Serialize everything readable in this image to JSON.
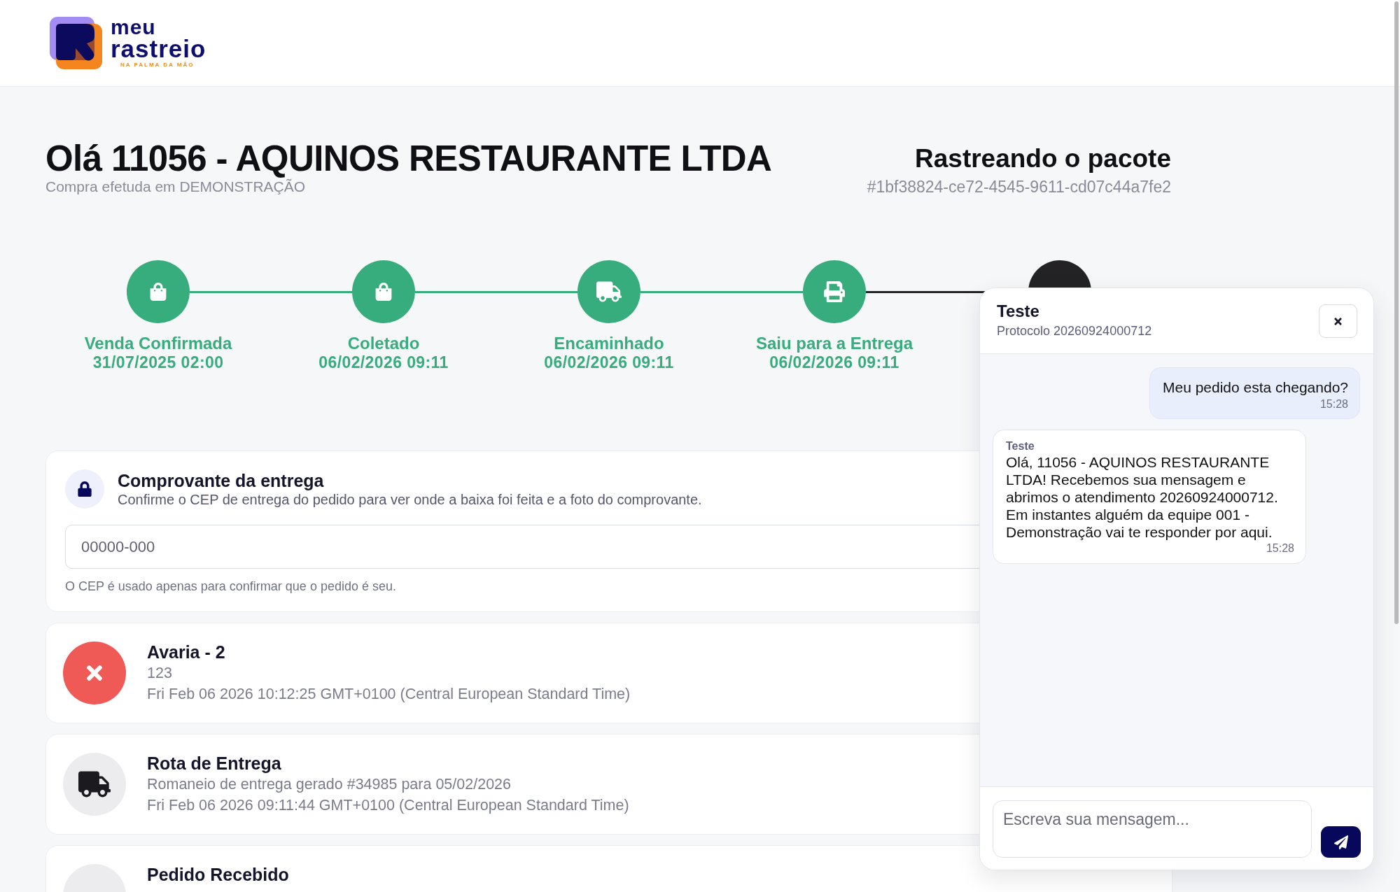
{
  "header": {
    "logo": {
      "line_1": "meu",
      "line_2": "rastreio",
      "tagline": "NA PALMA DA MÃO"
    }
  },
  "greeting": {
    "title": "Olá 11056 - AQUINOS RESTAURANTE LTDA",
    "subtitle": "Compra efetuda em DEMONSTRAÇÃO"
  },
  "tracking": {
    "title": "Rastreando o pacote",
    "code": "#1bf38824-ce72-4545-9611-cd07c44a7fe2"
  },
  "steps": [
    {
      "label": "Venda Confirmada",
      "date": "31/07/2025 02:00",
      "completed": true
    },
    {
      "label": "Coletado",
      "date": "06/02/2026 09:11",
      "completed": true
    },
    {
      "label": "Encaminhado",
      "date": "06/02/2026 09:11",
      "completed": true
    },
    {
      "label": "Saiu para a Entrega",
      "date": "06/02/2026 09:11",
      "completed": true
    },
    {
      "completed": false
    }
  ],
  "proof_card": {
    "title": "Comprovante da entrega",
    "description": "Confirme o CEP de entrega do pedido para ver onde a baixa foi feita e a foto do comprovante.",
    "cep_field": {
      "placeholder": "00000-000"
    },
    "note": "O CEP é usado apenas para confirmar que o pedido é seu."
  },
  "events": [
    {
      "kind": "damage",
      "title": "Avaria - 2",
      "lines": [
        "123",
        "Fri Feb 06 2026 10:12:25 GMT+0100 (Central European Standard Time)"
      ]
    },
    {
      "kind": "route",
      "title": "Rota de Entrega",
      "lines": [
        "Romaneio de entrega gerado #34985 para 05/02/2026",
        "Fri Feb 06 2026 09:11:44 GMT+0100 (Central European Standard Time)"
      ]
    },
    {
      "kind": "received",
      "title": "Pedido Recebido"
    }
  ],
  "chat": {
    "title": "Teste",
    "protocol": "Protocolo 20260924000712",
    "messages": [
      {
        "kind": "outgoing",
        "text": "Meu pedido esta chegando?",
        "time": "15:28"
      },
      {
        "kind": "incoming",
        "sender": "Teste",
        "text": "Olá, 11056 - AQUINOS RESTAURANTE LTDA! Recebemos sua mensagem e abrimos o atendimento 20260924000712. Em instantes alguém da equipe 001 - Demonstração vai te responder por aqui.",
        "time": "15:28"
      }
    ],
    "composer": {
      "placeholder": "Escreva sua mensagem..."
    }
  }
}
